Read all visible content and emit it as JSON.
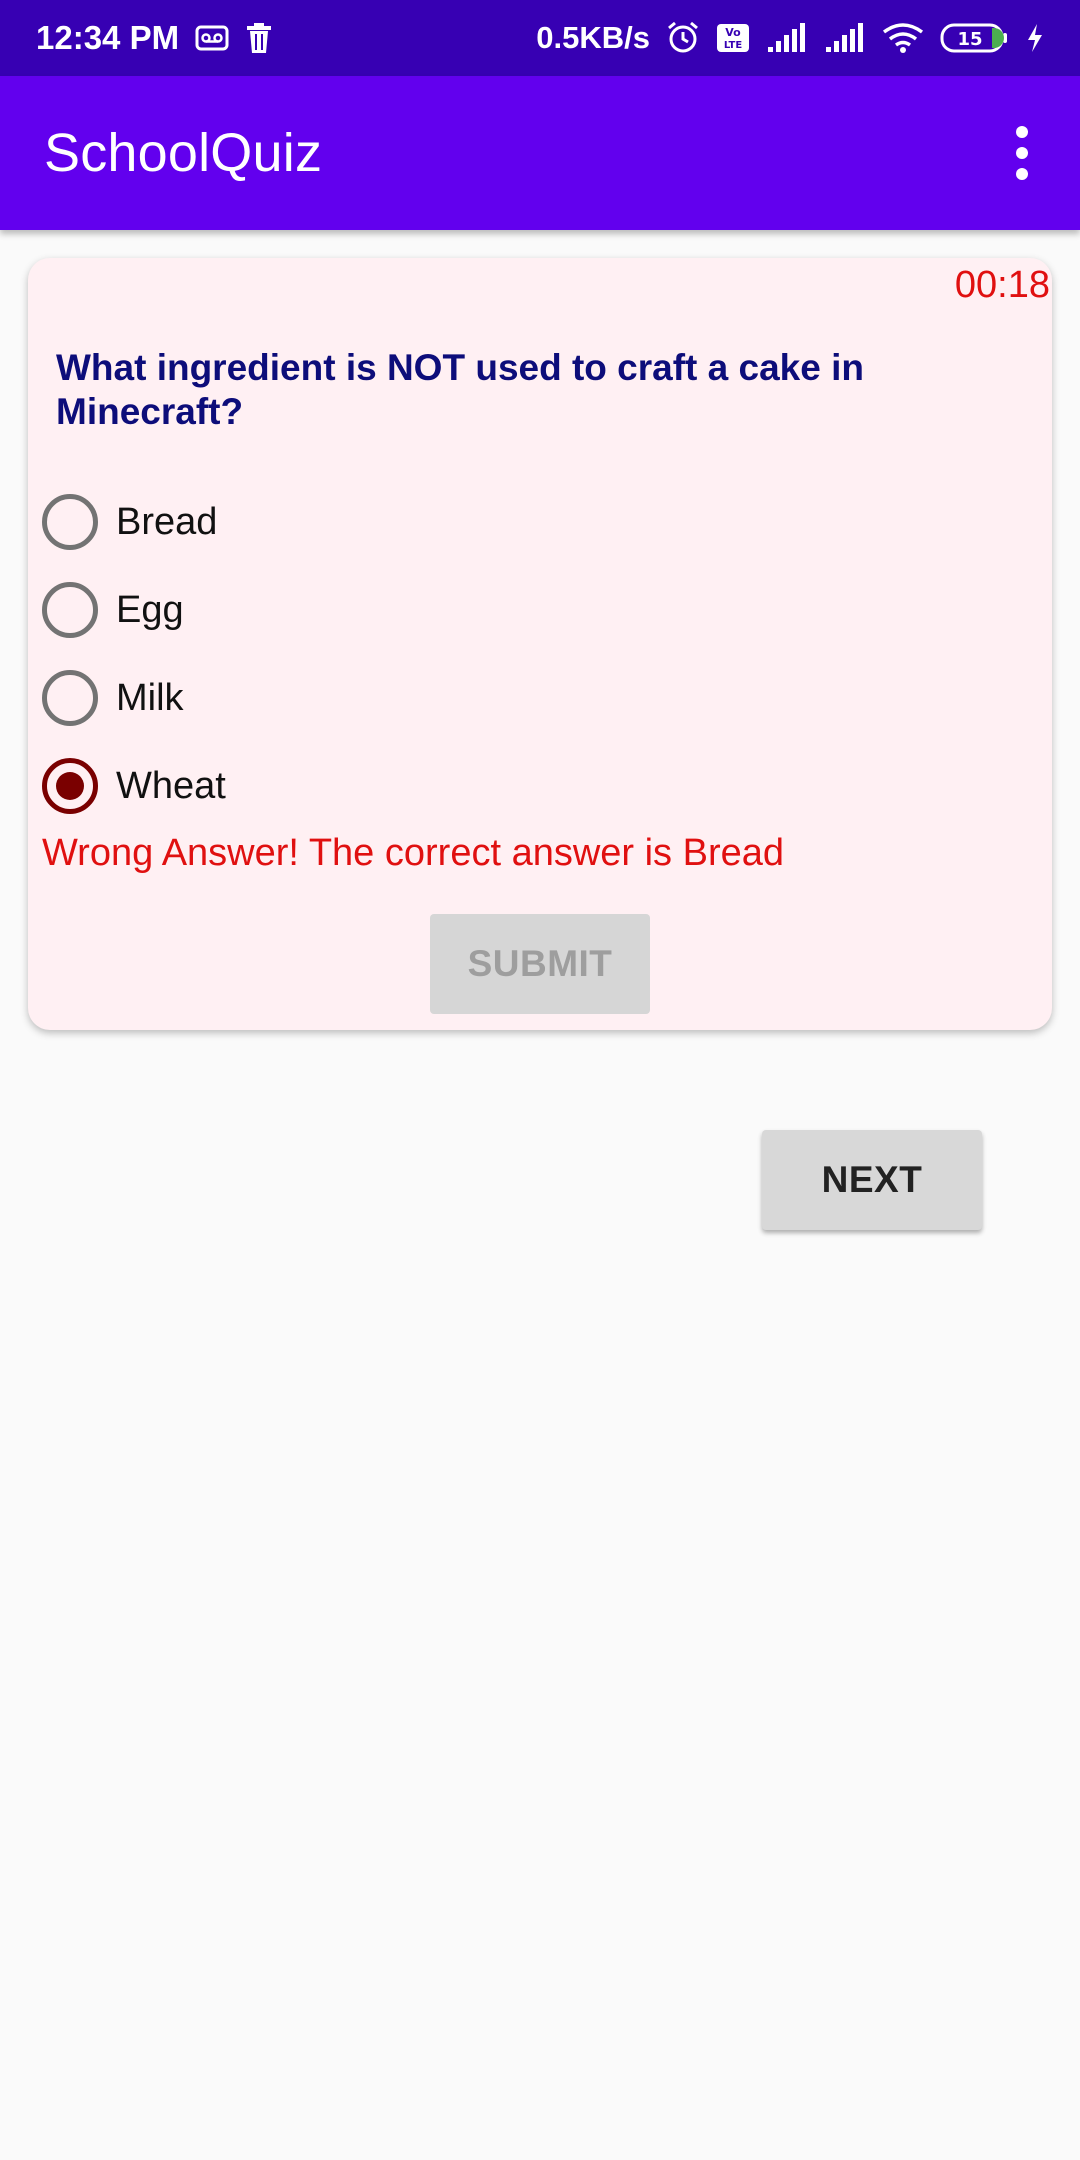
{
  "status_bar": {
    "time": "12:34 PM",
    "network_speed": "0.5KB/s",
    "battery_level": "15",
    "icons": [
      "voicemail-icon",
      "trash-icon",
      "alarm-icon",
      "volte-icon",
      "signal-icon",
      "signal-icon",
      "wifi-icon",
      "battery-icon",
      "charging-icon"
    ]
  },
  "app_bar": {
    "title": "SchoolQuiz",
    "menu_icon": "more-vert-icon"
  },
  "quiz": {
    "timer": "00:18",
    "question": "What ingredient is NOT used to craft a cake in Minecraft?",
    "options": [
      {
        "label": "Bread",
        "selected": false
      },
      {
        "label": "Egg",
        "selected": false
      },
      {
        "label": "Milk",
        "selected": false
      },
      {
        "label": "Wheat",
        "selected": true
      }
    ],
    "feedback": "Wrong Answer! The correct answer is Bread",
    "submit_label": "SUBMIT",
    "submit_enabled": false
  },
  "next_label": "NEXT",
  "colors": {
    "status_bar": "#3700b3",
    "app_bar": "#6200ee",
    "card_background": "#fff0f3",
    "question_text": "#0d0d7a",
    "error_text": "#e01010",
    "radio_selected": "#7a0000"
  }
}
